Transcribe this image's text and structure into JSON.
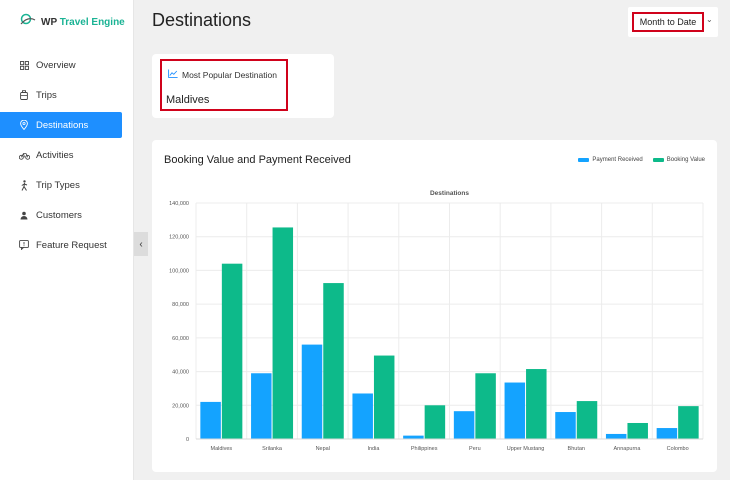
{
  "app": {
    "logo_wp": "WP",
    "logo_te": "Travel Engine"
  },
  "sidebar": {
    "items": [
      {
        "label": "Overview",
        "icon": "grid-icon",
        "active": false
      },
      {
        "label": "Trips",
        "icon": "luggage-icon",
        "active": false
      },
      {
        "label": "Destinations",
        "icon": "location-pin-icon",
        "active": true
      },
      {
        "label": "Activities",
        "icon": "bicycle-icon",
        "active": false
      },
      {
        "label": "Trip Types",
        "icon": "hiker-icon",
        "active": false
      },
      {
        "label": "Customers",
        "icon": "user-icon",
        "active": false
      },
      {
        "label": "Feature Request",
        "icon": "feedback-icon",
        "active": false
      }
    ]
  },
  "header": {
    "title": "Destinations",
    "date_filter": "Month to Date"
  },
  "popular": {
    "label": "Most Popular Destination",
    "value": "Maldives"
  },
  "chart_card": {
    "title": "Booking Value and Payment Received"
  },
  "colors": {
    "accent": "#1e8fff",
    "payment": "#14a3ff",
    "booking": "#0dba8a",
    "highlight": "#d0021b"
  },
  "chart_data": {
    "type": "bar",
    "title": "Destinations",
    "xlabel": "",
    "ylabel": "",
    "categories": [
      "Maldives",
      "Srilanka",
      "Nepal",
      "India",
      "Philippines",
      "Peru",
      "Upper Mustang",
      "Bhutan",
      "Annapurna",
      "Colombo"
    ],
    "series": [
      {
        "name": "Payment Received",
        "values": [
          22000,
          39000,
          56000,
          27000,
          2000,
          16500,
          33500,
          16000,
          3000,
          6500
        ]
      },
      {
        "name": "Booking Value",
        "values": [
          104000,
          125500,
          92500,
          49500,
          20000,
          39000,
          41500,
          22500,
          9500,
          19500
        ]
      }
    ],
    "ylim": [
      0,
      140000
    ],
    "yticks": [
      0,
      20000,
      40000,
      60000,
      80000,
      100000,
      120000,
      140000
    ],
    "ytick_labels": [
      "0",
      "20,000",
      "40,000",
      "60,000",
      "80,000",
      "100,000",
      "120,000",
      "140,000"
    ],
    "grid": true,
    "legend_position": "top-right"
  }
}
